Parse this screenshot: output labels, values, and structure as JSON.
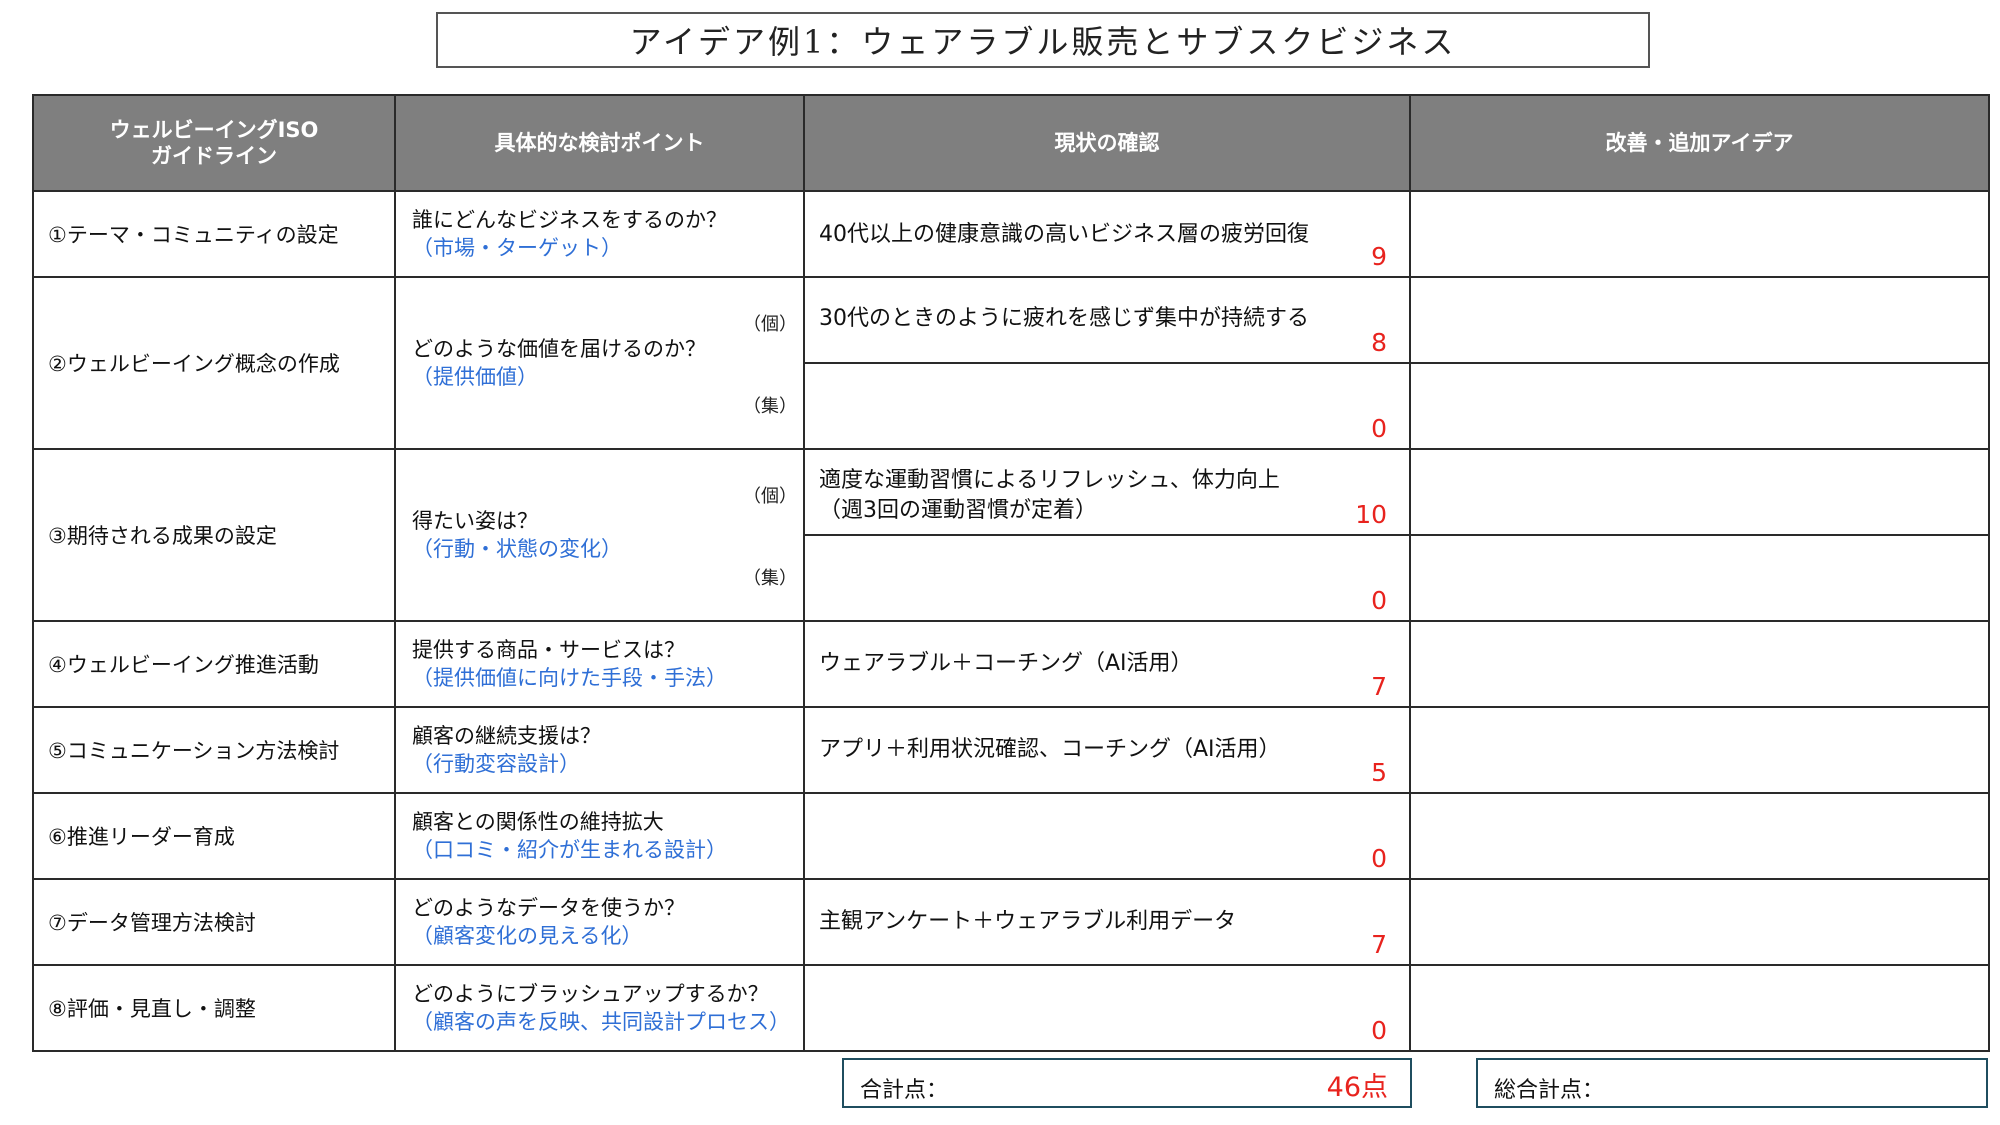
{
  "title": "アイデア例1：ウェアラブル販売とサブスクビジネス",
  "headers": {
    "guideline_line1": "ウェルビーイングISO",
    "guideline_line2": "ガイドライン",
    "points": "具体的な検討ポイント",
    "current": "現状の確認",
    "ideas": "改善・追加アイデア"
  },
  "tags": {
    "individual": "（個）",
    "group": "（集）"
  },
  "rows": [
    {
      "guideline": "①テーマ・コミュニティの設定",
      "question": "誰にどんなビジネスをするのか？",
      "sub": "（市場・ターゲット）",
      "current": "40代以上の健康意識の高いビジネス層の疲労回復",
      "score": "9"
    },
    {
      "guideline": "②ウェルビーイング概念の作成",
      "question": "どのような価値を届けるのか？",
      "sub": "（提供価値）",
      "current_individual": "30代のときのように疲れを感じず集中が持続する",
      "score_individual": "8",
      "current_group": "",
      "score_group": "0"
    },
    {
      "guideline": "③期待される成果の設定",
      "question": "得たい姿は？",
      "sub": "（行動・状態の変化）",
      "current_individual_line1": "適度な運動習慣によるリフレッシュ、体力向上",
      "current_individual_line2": "（週3回の運動習慣が定着）",
      "score_individual": "10",
      "current_group": "",
      "score_group": "0"
    },
    {
      "guideline": "④ウェルビーイング推進活動",
      "question": "提供する商品・サービスは？",
      "sub": "（提供価値に向けた手段・手法）",
      "current": "ウェアラブル＋コーチング（AI活用）",
      "score": "7"
    },
    {
      "guideline": "⑤コミュニケーション方法検討",
      "question": "顧客の継続支援は？",
      "sub": "（行動変容設計）",
      "current": "アプリ＋利用状況確認、コーチング（AI活用）",
      "score": "5"
    },
    {
      "guideline": "⑥推進リーダー育成",
      "question": "顧客との関係性の維持拡大",
      "sub": "（口コミ・紹介が生まれる設計）",
      "current": "",
      "score": "0"
    },
    {
      "guideline": "⑦データ管理方法検討",
      "question": "どのようなデータを使うか？",
      "sub": "（顧客変化の見える化）",
      "current": "主観アンケート＋ウェアラブル利用データ",
      "score": "7"
    },
    {
      "guideline": "⑧評価・見直し・調整",
      "question": "どのようにブラッシュアップするか？",
      "sub": "（顧客の声を反映、共同設計プロセス）",
      "current": "",
      "score": "0"
    }
  ],
  "totals": {
    "subtotal_label": "合計点：",
    "subtotal_value": "46点",
    "grand_label": "総合計点："
  },
  "colors": {
    "header_bg": "#7f7f7f",
    "score": "#e8231e",
    "sub_text": "#2f6fd6"
  }
}
